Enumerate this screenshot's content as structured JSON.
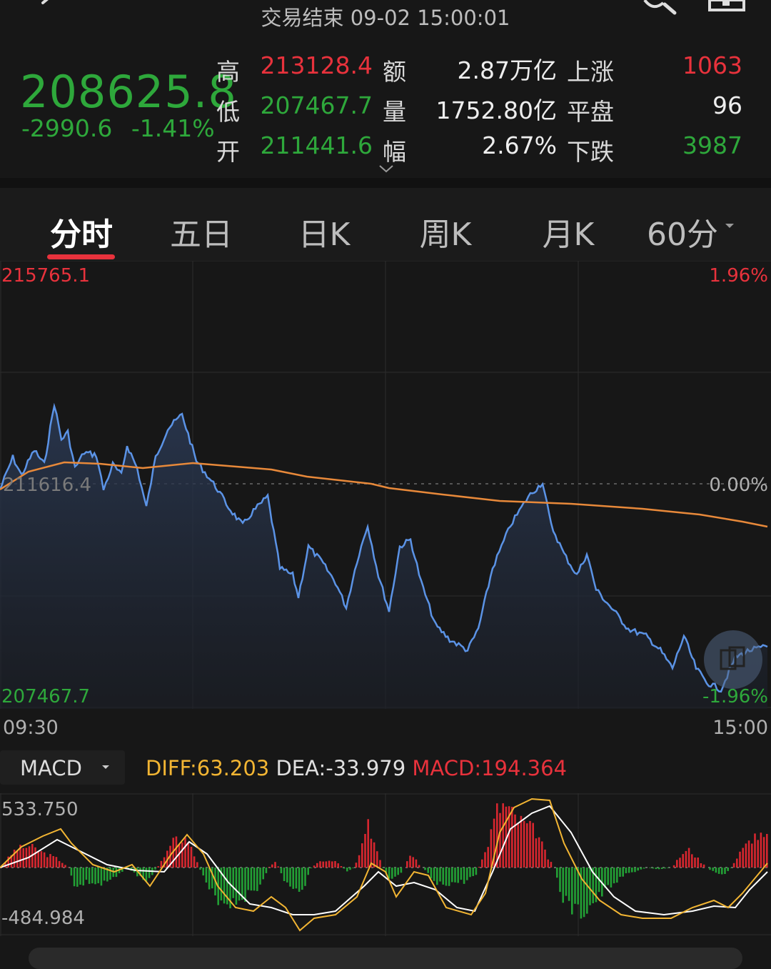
{
  "header": {
    "status_text": "交易结束 09-02 15:00:01"
  },
  "quote": {
    "price": "208625.8",
    "change": "-2990.6",
    "change_pct": "-1.41%",
    "stats": [
      {
        "label": "高",
        "value": "213128.4",
        "color": "#e8323c"
      },
      {
        "label": "低",
        "value": "207467.7",
        "color": "#2ea83b"
      },
      {
        "label": "开",
        "value": "211441.6",
        "color": "#2ea83b"
      }
    ],
    "stats2": [
      {
        "label": "额",
        "value": "2.87万亿"
      },
      {
        "label": "量",
        "value": "1752.80亿"
      },
      {
        "label": "幅",
        "value": "2.67%"
      }
    ],
    "breadth": [
      {
        "label": "上涨",
        "value": "1063",
        "color": "#e8323c"
      },
      {
        "label": "平盘",
        "value": "96",
        "color": "#eeeeee"
      },
      {
        "label": "下跌",
        "value": "3987",
        "color": "#2ea83b"
      }
    ]
  },
  "tabs": [
    "分时",
    "五日",
    "日K",
    "周K",
    "月K",
    "60分"
  ],
  "active_tab": "分时",
  "chart": {
    "y_max": "215765.1",
    "y_min": "207467.7",
    "y_mid": "211616.4",
    "pct_max": "1.96%",
    "pct_mid": "0.00%",
    "pct_min": "-1.96%",
    "time_start": "09:30",
    "time_end": "15:00"
  },
  "macd": {
    "selector": "MACD",
    "diff_label": "DIFF:",
    "diff_value": "63.203",
    "dea_label": "DEA:",
    "dea_value": "-33.979",
    "macd_label": "MACD:",
    "macd_value": "194.364",
    "y_max": "533.750",
    "y_min": "-484.984"
  },
  "chart_data": {
    "type": "line",
    "x": [
      "09:30",
      "15:00"
    ],
    "ylim": [
      207467.7,
      215765.1
    ],
    "series": [],
    "colors": {
      "price": "#5b93e6",
      "avg": "#e8893a",
      "up": "#e8323c",
      "down": "#2ea83b",
      "dea": "#ffffff",
      "diff": "#f2b533"
    }
  }
}
